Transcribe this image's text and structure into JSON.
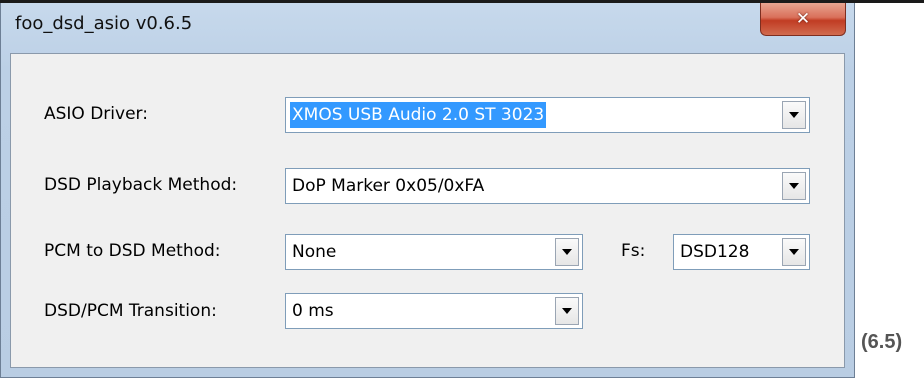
{
  "window": {
    "title": "foo_dsd_asio v0.6.5",
    "close_icon": "x-close-icon"
  },
  "form": {
    "asio_driver": {
      "label": "ASIO Driver:",
      "value": "XMOS USB Audio 2.0 ST 3023"
    },
    "dsd_playback_method": {
      "label": "DSD Playback Method:",
      "value": "DoP Marker 0x05/0xFA"
    },
    "pcm_to_dsd_method": {
      "label": "PCM to DSD Method:",
      "value": "None"
    },
    "fs": {
      "label": "Fs:",
      "value": "DSD128"
    },
    "dsd_pcm_transition": {
      "label": "DSD/PCM Transition:",
      "value": "0 ms"
    }
  },
  "caption": "(6.5)",
  "colors": {
    "selection": "#3399ff",
    "close_button": "#c13c23",
    "frame": "#b9cde3",
    "client": "#f0f0f0"
  }
}
